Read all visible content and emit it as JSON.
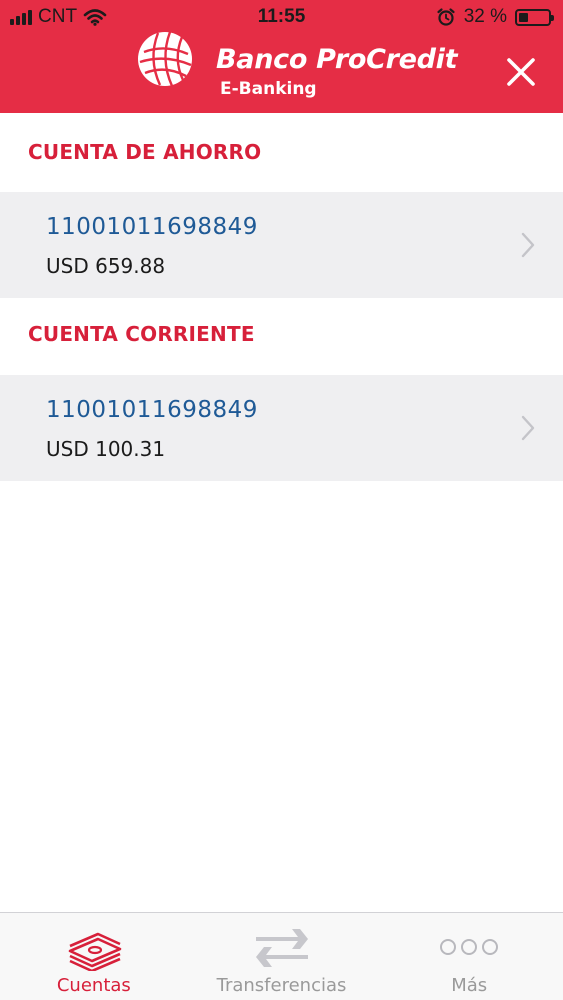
{
  "status_bar": {
    "carrier": "CNT",
    "time": "11:55",
    "battery": "32 %",
    "battery_level": 0.32
  },
  "header": {
    "bank_name": "Banco ProCredit",
    "subtitle": "E-Banking",
    "close_icon": "close-icon",
    "color": "#e52d45"
  },
  "sections": [
    {
      "title": "CUENTA DE AHORRO",
      "account": {
        "number": "11001011698849",
        "balance": "USD 659.88"
      }
    },
    {
      "title": "CUENTA CORRIENTE",
      "account": {
        "number": "11001011698849",
        "balance": "USD 100.31"
      }
    }
  ],
  "tabs": [
    {
      "label": "Cuentas",
      "icon": "banknotes-icon",
      "active": true
    },
    {
      "label": "Transferencias",
      "icon": "transfer-arrows-icon",
      "active": false
    },
    {
      "label": "Más",
      "icon": "more-dots-icon",
      "active": false
    }
  ],
  "colors": {
    "accent": "#d7203a",
    "account_number": "#1f5a96",
    "row_background": "#efeff1"
  }
}
